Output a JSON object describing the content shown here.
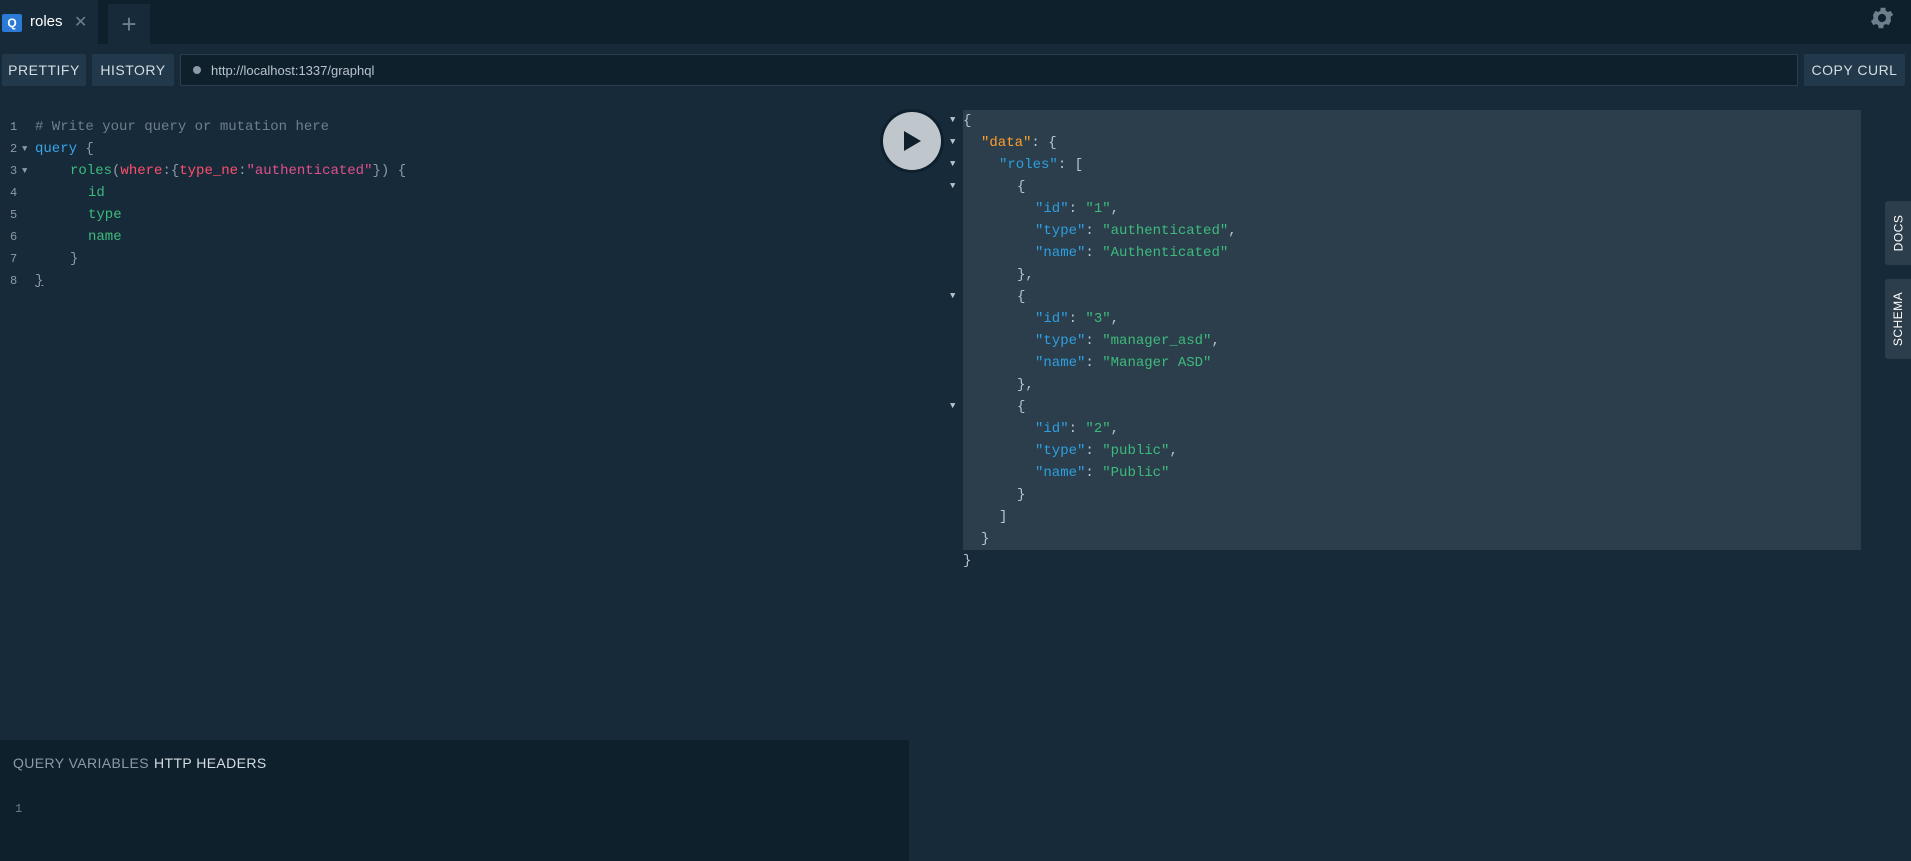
{
  "tabs": {
    "items": [
      {
        "badge": "Q",
        "label": "roles",
        "close": "✕"
      }
    ],
    "add_symbol": "+"
  },
  "toolbar": {
    "prettify_label": "PRETTIFY",
    "history_label": "HISTORY",
    "url": "http://localhost:1337/graphql",
    "copy_curl_label": "COPY CURL"
  },
  "editor": {
    "line_numbers": [
      "1",
      "2",
      "3",
      "4",
      "5",
      "6",
      "7",
      "8"
    ],
    "line1": "# Write your query or mutation here",
    "line2_kw": "query",
    "line2_punc": " {",
    "line3_field": "roles",
    "line3_open": "(",
    "line3_arg": "where",
    "line3_colon1": ":",
    "line3_brace_open": "{",
    "line3_arg2": "type_ne",
    "line3_colon2": ":",
    "line3_str": "\"authenticated\"",
    "line3_close": "}) {",
    "line4": "id",
    "line5": "type",
    "line6": "name",
    "line7": "}",
    "line8": "}"
  },
  "variables_panel": {
    "tab_query_variables": "QUERY VARIABLES",
    "tab_http_headers": "HTTP HEADERS",
    "line_number": "1"
  },
  "result": {
    "brace_open": "{",
    "data_key": "\"data\"",
    "roles_key": "\"roles\"",
    "roles": [
      {
        "id": "\"1\"",
        "type": "\"authenticated\"",
        "name": "\"Authenticated\""
      },
      {
        "id": "\"3\"",
        "type": "\"manager_asd\"",
        "name": "\"Manager ASD\""
      },
      {
        "id": "\"2\"",
        "type": "\"public\"",
        "name": "\"Public\""
      }
    ],
    "id_key": "\"id\"",
    "type_key": "\"type\"",
    "name_key": "\"name\"",
    "brace_close": "}"
  },
  "side_tabs": {
    "docs_label": "DOCS",
    "schema_label": "SCHEMA"
  },
  "colors": {
    "background": "#172a3a",
    "dark_background": "#0f202d",
    "result_highlight": "#2c3e4c",
    "keyword": "#3aa4e5",
    "field": "#3dbb7c",
    "argument": "#ff4f6b",
    "string_literal": "#e2508a",
    "json_top_key": "#ff9f2c"
  }
}
